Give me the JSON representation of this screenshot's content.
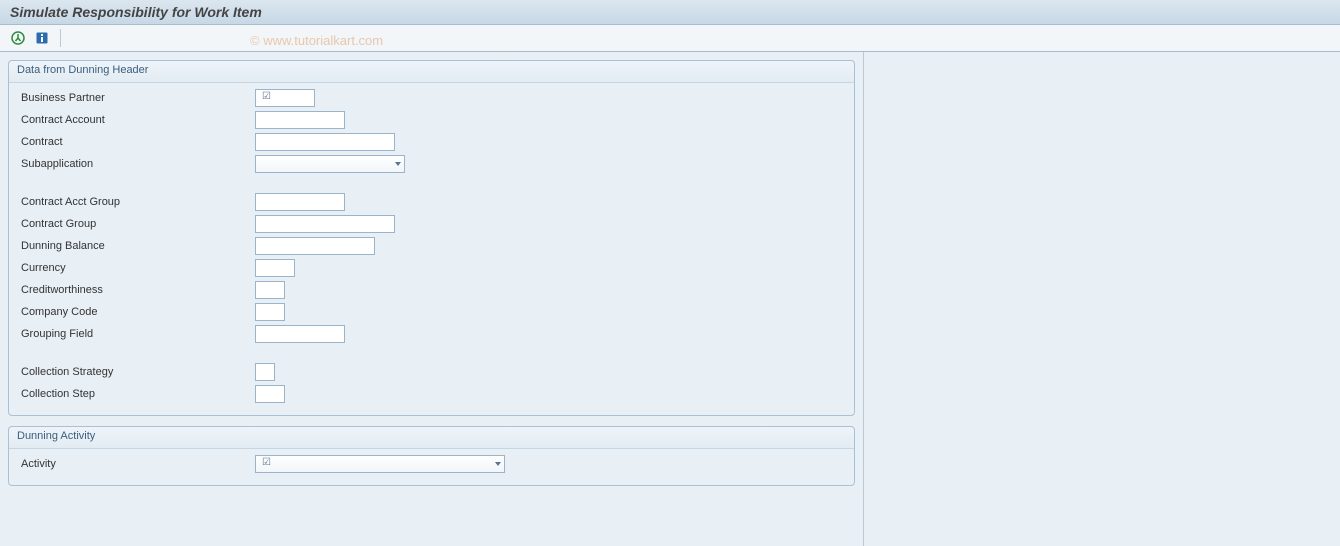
{
  "title": "Simulate Responsibility for Work Item",
  "toolbar": {
    "execute_tip": "Execute",
    "info_tip": "Information"
  },
  "watermark": "© www.tutorialkart.com",
  "group1": {
    "title": "Data from Dunning Header",
    "fields": {
      "business_partner": {
        "label": "Business Partner",
        "value": ""
      },
      "contract_account": {
        "label": "Contract Account",
        "value": ""
      },
      "contract": {
        "label": "Contract",
        "value": ""
      },
      "subapplication": {
        "label": "Subapplication",
        "value": ""
      },
      "contract_acct_group": {
        "label": "Contract Acct Group",
        "value": ""
      },
      "contract_group": {
        "label": "Contract Group",
        "value": ""
      },
      "dunning_balance": {
        "label": "Dunning Balance",
        "value": ""
      },
      "currency": {
        "label": "Currency",
        "value": ""
      },
      "creditworthiness": {
        "label": "Creditworthiness",
        "value": ""
      },
      "company_code": {
        "label": "Company Code",
        "value": ""
      },
      "grouping_field": {
        "label": "Grouping Field",
        "value": ""
      },
      "collection_strategy": {
        "label": "Collection Strategy",
        "value": ""
      },
      "collection_step": {
        "label": "Collection Step",
        "value": ""
      }
    }
  },
  "group2": {
    "title": "Dunning Activity",
    "fields": {
      "activity": {
        "label": "Activity",
        "value": ""
      }
    }
  }
}
